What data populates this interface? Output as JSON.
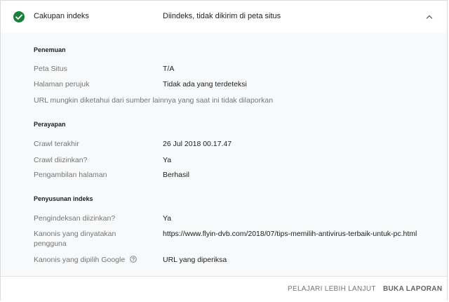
{
  "header": {
    "title": "Cakupan indeks",
    "status": "Diindeks, tidak dikirim di peta situs",
    "status_color": "#188038",
    "icon": "check-circle-icon",
    "toggle_icon": "chevron-up-icon"
  },
  "discovery": {
    "title": "Penemuan",
    "sitemap_label": "Peta Situs",
    "sitemap_value": "T/A",
    "referring_label": "Halaman perujuk",
    "referring_value": "Tidak ada yang terdeteksi",
    "note": "URL mungkin diketahui dari sumber lainnya yang saat ini tidak dilaporkan"
  },
  "crawl": {
    "title": "Perayapan",
    "last_crawl_label": "Crawl terakhir",
    "last_crawl_value": "26 Jul 2018 00.17.47",
    "allowed_label": "Crawl diizinkan?",
    "allowed_value": "Ya",
    "fetch_label": "Pengambilan halaman",
    "fetch_value": "Berhasil"
  },
  "indexing": {
    "title": "Penyusunan indeks",
    "allowed_label": "Pengindeksan diizinkan?",
    "allowed_value": "Ya",
    "user_canonical_label_line1": "Kanonis yang dinyatakan",
    "user_canonical_label_line2": "pengguna",
    "user_canonical_value": "https://www.flyin-dvb.com/2018/07/tips-memilih-antivirus-terbaik-untuk-pc.html",
    "google_canonical_label": "Kanonis yang dipilih Google",
    "google_canonical_help_icon": "help-circle-icon",
    "google_canonical_value": "URL yang diperiksa"
  },
  "footer": {
    "learn_more": "PELAJARI LEBIH LANJUT",
    "open_report": "BUKA LAPORAN"
  }
}
